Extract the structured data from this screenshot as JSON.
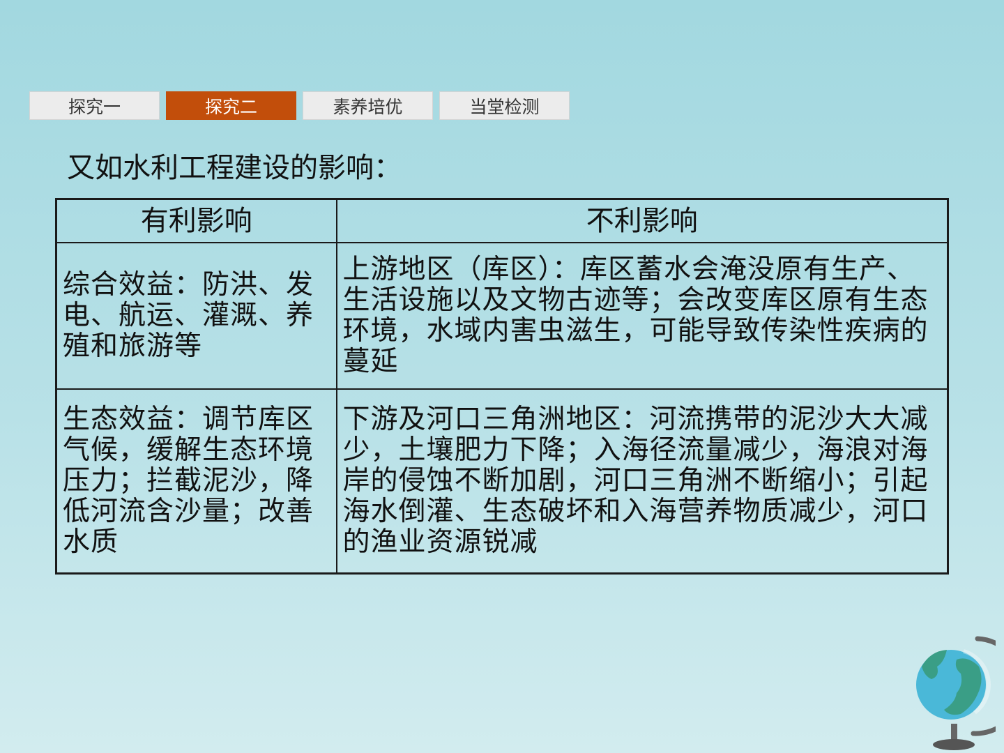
{
  "tabs": [
    {
      "label": "探究一",
      "active": false
    },
    {
      "label": "探究二",
      "active": true
    },
    {
      "label": "素养培优",
      "active": false
    },
    {
      "label": "当堂检测",
      "active": false
    }
  ],
  "heading": "又如水利工程建设的影响：",
  "table": {
    "headers": [
      "有利影响",
      "不利影响"
    ],
    "rows": [
      {
        "positive": "综合效益：防洪、发电、航运、灌溉、养殖和旅游等",
        "negative": "上游地区（库区）：库区蓄水会淹没原有生产、生活设施以及文物古迹等；会改变库区原有生态环境，水域内害虫滋生，可能导致传染性疾病的蔓延"
      },
      {
        "positive": "生态效益：调节库区气候，缓解生态环境压力；拦截泥沙，降低河流含沙量；改善水质",
        "negative": "下游及河口三角洲地区：河流携带的泥沙大大减少，土壤肥力下降；入海径流量减少，海浪对海岸的侵蚀不断加剧，河口三角洲不断缩小；引起海水倒灌、生态破坏和入海营养物质减少，河口的渔业资源锐减"
      }
    ]
  },
  "colors": {
    "active_tab": "#c24e0b",
    "inactive_tab": "#ececec",
    "background": "#a2d8e0",
    "globe_ocean": "#4ab8d8",
    "globe_land": "#3a9e86"
  },
  "decor": {
    "icon": "globe-icon"
  }
}
